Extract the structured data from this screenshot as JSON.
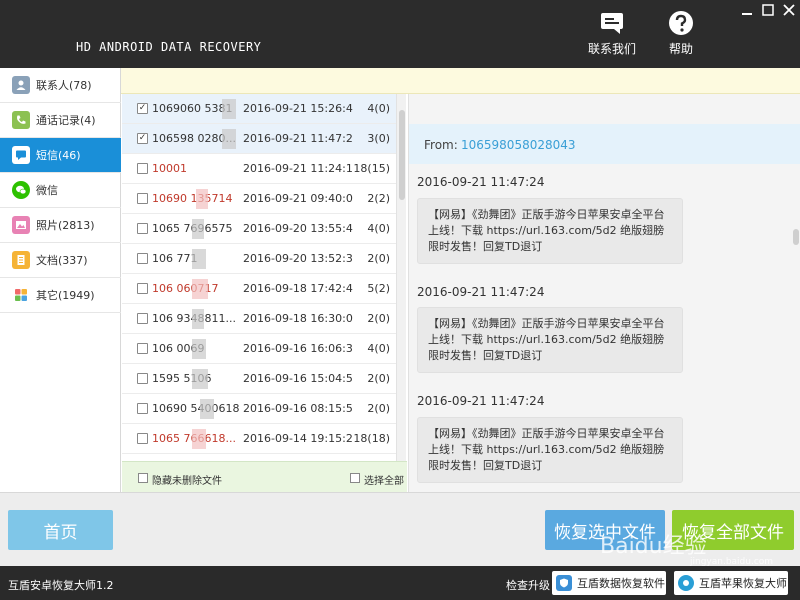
{
  "header": {
    "app_title": "HD ANDROID DATA RECOVERY",
    "contact_label": "联系我们",
    "help_label": "帮助"
  },
  "sidebar": {
    "items": [
      {
        "label": "联系人(78)",
        "icon": "contacts-icon",
        "color": "#8aa1b8"
      },
      {
        "label": "通话记录(4)",
        "icon": "call-log-icon",
        "color": "#8cc152"
      },
      {
        "label": "短信(46)",
        "icon": "sms-icon",
        "color": "#ffffff"
      },
      {
        "label": "微信",
        "icon": "wechat-icon",
        "color": "#2dc100"
      },
      {
        "label": "照片(2813)",
        "icon": "photos-icon",
        "color": "#e882b4"
      },
      {
        "label": "文档(337)",
        "icon": "documents-icon",
        "color": "#f5b335"
      },
      {
        "label": "其它(1949)",
        "icon": "other-icon",
        "color": "#f06a6a"
      }
    ]
  },
  "messages": [
    {
      "number": "1069060  5381",
      "date": "2016-09-21 15:26:4",
      "count": "4(0)",
      "checked": true,
      "unread": false
    },
    {
      "number": "106598  0280...",
      "date": "2016-09-21 11:47:2",
      "count": "3(0)",
      "checked": true,
      "unread": false
    },
    {
      "number": "10001",
      "date": "2016-09-21 11:24:1",
      "count": "18(15)",
      "checked": false,
      "unread": true
    },
    {
      "number": "10690  135714",
      "date": "2016-09-21 09:40:0",
      "count": "2(2)",
      "checked": false,
      "unread": true
    },
    {
      "number": "1065  7696575",
      "date": "2016-09-20 13:55:4",
      "count": "4(0)",
      "checked": false,
      "unread": false
    },
    {
      "number": "106  771",
      "date": "2016-09-20 13:52:3",
      "count": "2(0)",
      "checked": false,
      "unread": false
    },
    {
      "number": "106  060717",
      "date": "2016-09-18 17:42:4",
      "count": "5(2)",
      "checked": false,
      "unread": true
    },
    {
      "number": "106  9348811...",
      "date": "2016-09-18 16:30:0",
      "count": "2(0)",
      "checked": false,
      "unread": false
    },
    {
      "number": "106  0069",
      "date": "2016-09-16 16:06:3",
      "count": "4(0)",
      "checked": false,
      "unread": false
    },
    {
      "number": "1595  5106",
      "date": "2016-09-16 15:04:5",
      "count": "2(0)",
      "checked": false,
      "unread": false
    },
    {
      "number": "10690  5400618",
      "date": "2016-09-16 08:15:5",
      "count": "2(0)",
      "checked": false,
      "unread": false
    },
    {
      "number": "1065  766618...",
      "date": "2016-09-14 19:15:2",
      "count": "18(18)",
      "checked": false,
      "unread": true
    }
  ],
  "list_footer": {
    "hide_deleted_label": "隐藏未删除文件",
    "select_all_label": "选择全部"
  },
  "detail": {
    "from_label": "From:",
    "from_number": "106598058028043",
    "messages": [
      {
        "time": "2016-09-21 11:47:24",
        "text": "【网易】《劲舞团》正版手游今日苹果安卓全平台上线！下载 https://url.163.com/5d2 绝版翅膀限时发售！回复TD退订"
      },
      {
        "time": "2016-09-21 11:47:24",
        "text": "【网易】《劲舞团》正版手游今日苹果安卓全平台上线！下载 https://url.163.com/5d2 绝版翅膀限时发售！回复TD退订"
      },
      {
        "time": "2016-09-21 11:47:24",
        "text": "【网易】《劲舞团》正版手游今日苹果安卓全平台上线！下载 https://url.163.com/5d2 绝版翅膀限时发售！回复TD退订"
      }
    ]
  },
  "actions": {
    "home_label": "首页",
    "recover_selected_label": "恢复选中文件",
    "recover_all_label": "恢复全部文件"
  },
  "status": {
    "version": "互盾安卓恢复大师1.2",
    "upgrade_label": "检查升级",
    "data_recovery_label": "互盾数据恢复软件",
    "apple_recovery_label": "互盾苹果恢复大师"
  },
  "watermark": {
    "text": "Baidu经验",
    "url": "jingyan.baidu.com"
  },
  "colors": {
    "header_bg": "#2c2c2c",
    "sidebar_active": "#1a8fd8",
    "from_number": "#3a9fd6",
    "unread_number": "#c0392b",
    "btn_home": "#7fc6e8",
    "btn_selected": "#5aa9e0",
    "btn_all": "#8fcc2d"
  }
}
